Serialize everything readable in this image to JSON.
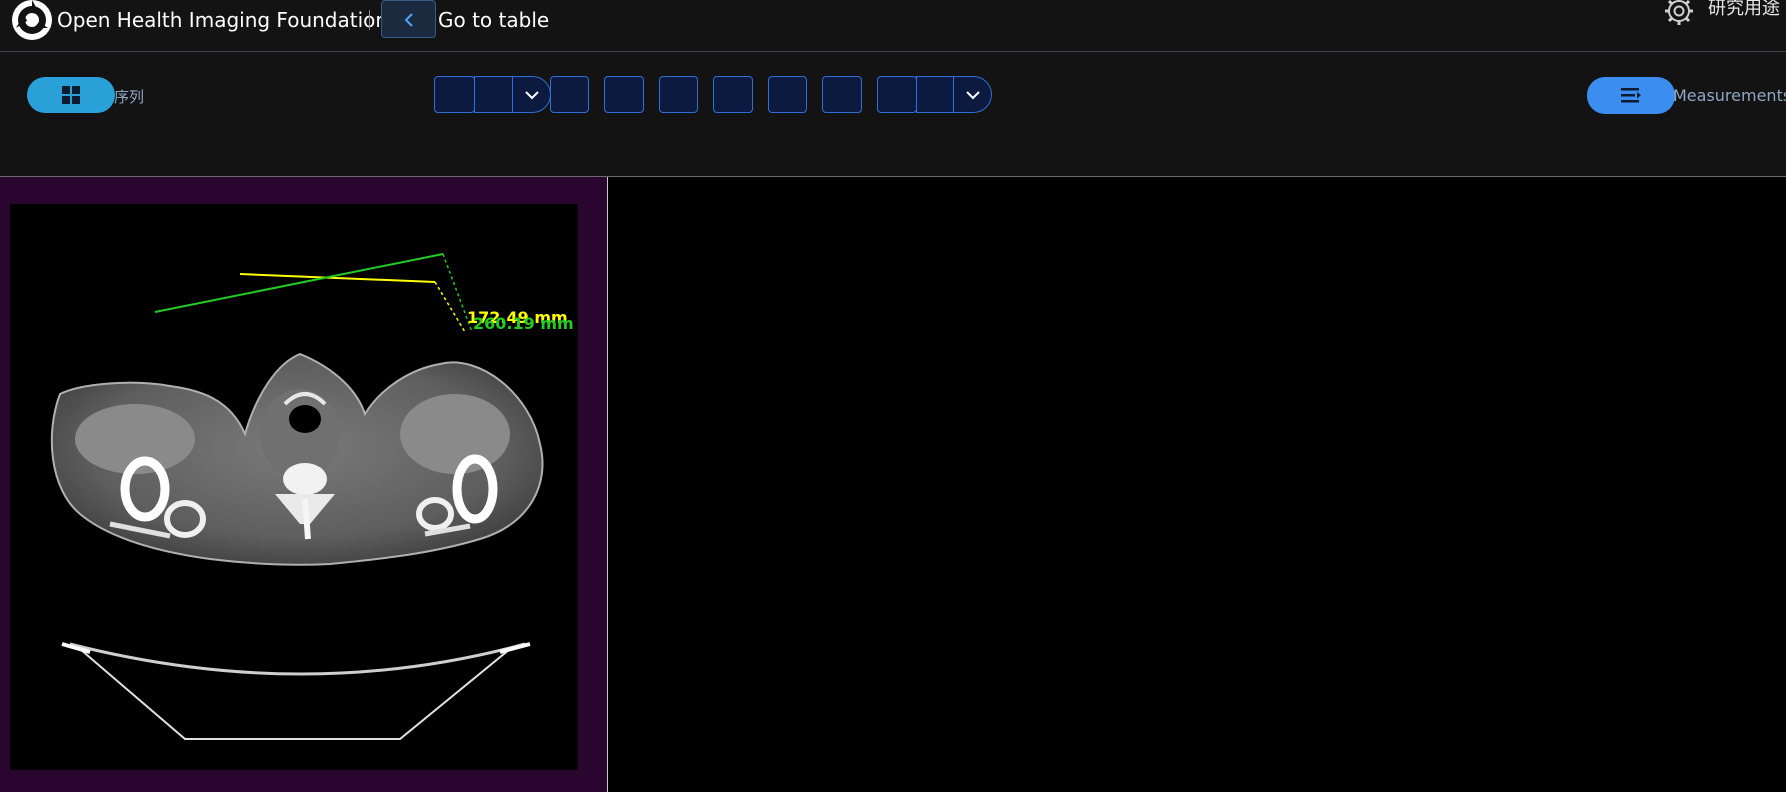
{
  "header": {
    "app_title": "Open Health Imaging Foundation",
    "back_label": "Go to table",
    "study_label": "研究用途"
  },
  "toolbar": {
    "series_label": "序列",
    "measurements_label": "Measurements"
  },
  "viewport": {
    "measurements": [
      {
        "label": "172.49 mm",
        "color": "#ffff00"
      },
      {
        "label": "260.19 mm",
        "color": "#22cc22"
      }
    ]
  },
  "colors": {
    "header_bg": "#131313",
    "accent_blue": "#3b8ef0",
    "series_blue": "#2aa0d8",
    "viewport_active_border": "#2a0530"
  }
}
